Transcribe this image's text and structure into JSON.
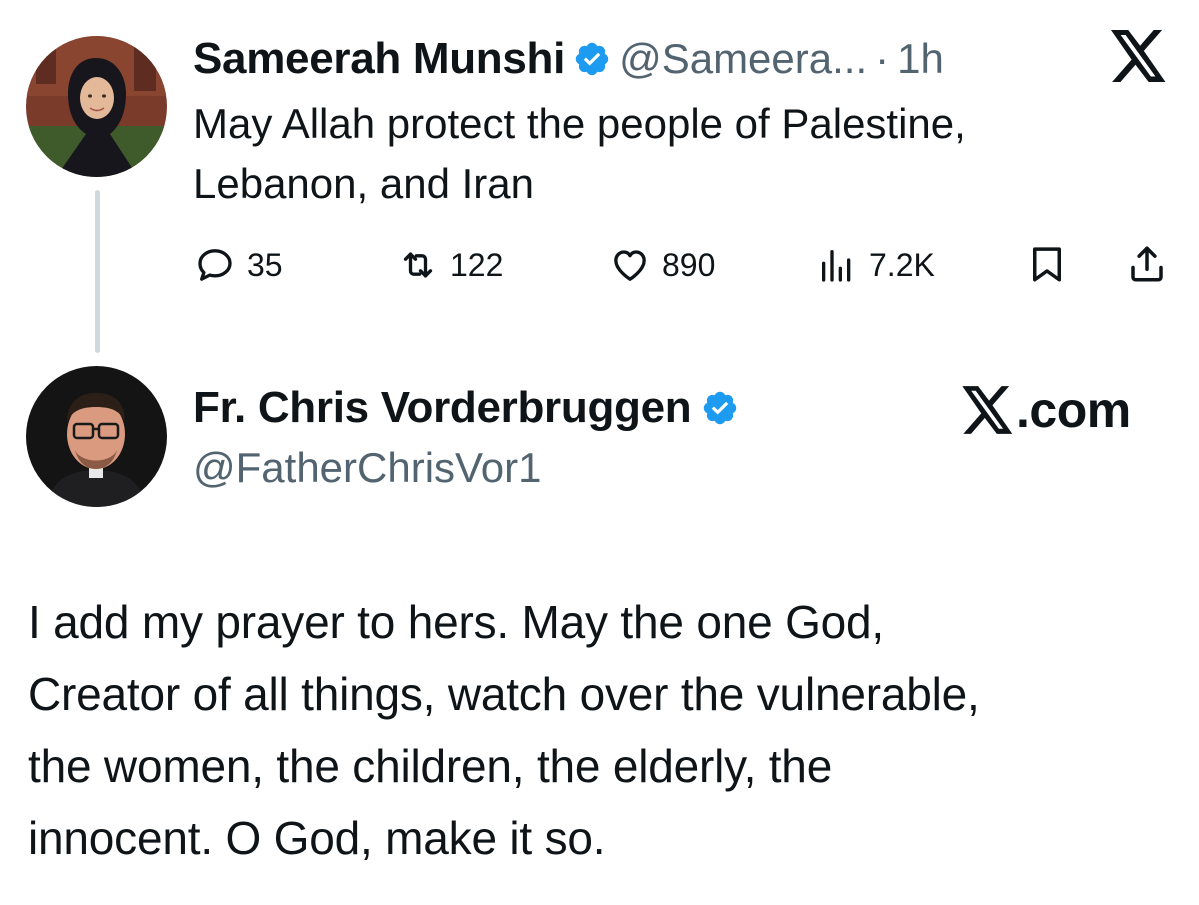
{
  "tweet1": {
    "display_name": "Sameerah Munshi",
    "handle": "@Sameera...",
    "separator": "·",
    "time": "1h",
    "text_line1": "May Allah protect the people of Palestine,",
    "text_line2": "Lebanon, and Iran",
    "metrics": {
      "replies": "35",
      "reposts": "122",
      "likes": "890",
      "views": "7.2K"
    },
    "icons": {
      "reply": "reply-icon",
      "repost": "repost-icon",
      "like": "heart-icon",
      "views": "views-icon",
      "bookmark": "bookmark-icon",
      "share": "share-icon"
    }
  },
  "tweet2": {
    "display_name": "Fr. Chris Vorderbruggen",
    "handle": "@FatherChrisVor1",
    "text_lines": [
      "I add my prayer to hers. May the one God,",
      "Creator of all things, watch over the vulnerable,",
      "the women, the children, the elderly, the",
      "innocent. O God, make it so."
    ]
  },
  "branding": {
    "xcom_label": ".com",
    "x_logo": "x-logo-icon"
  },
  "colors": {
    "text": "#0f1419",
    "secondary": "#536471",
    "verified": "#1d9bf0",
    "thread_line": "#cfd9de"
  }
}
